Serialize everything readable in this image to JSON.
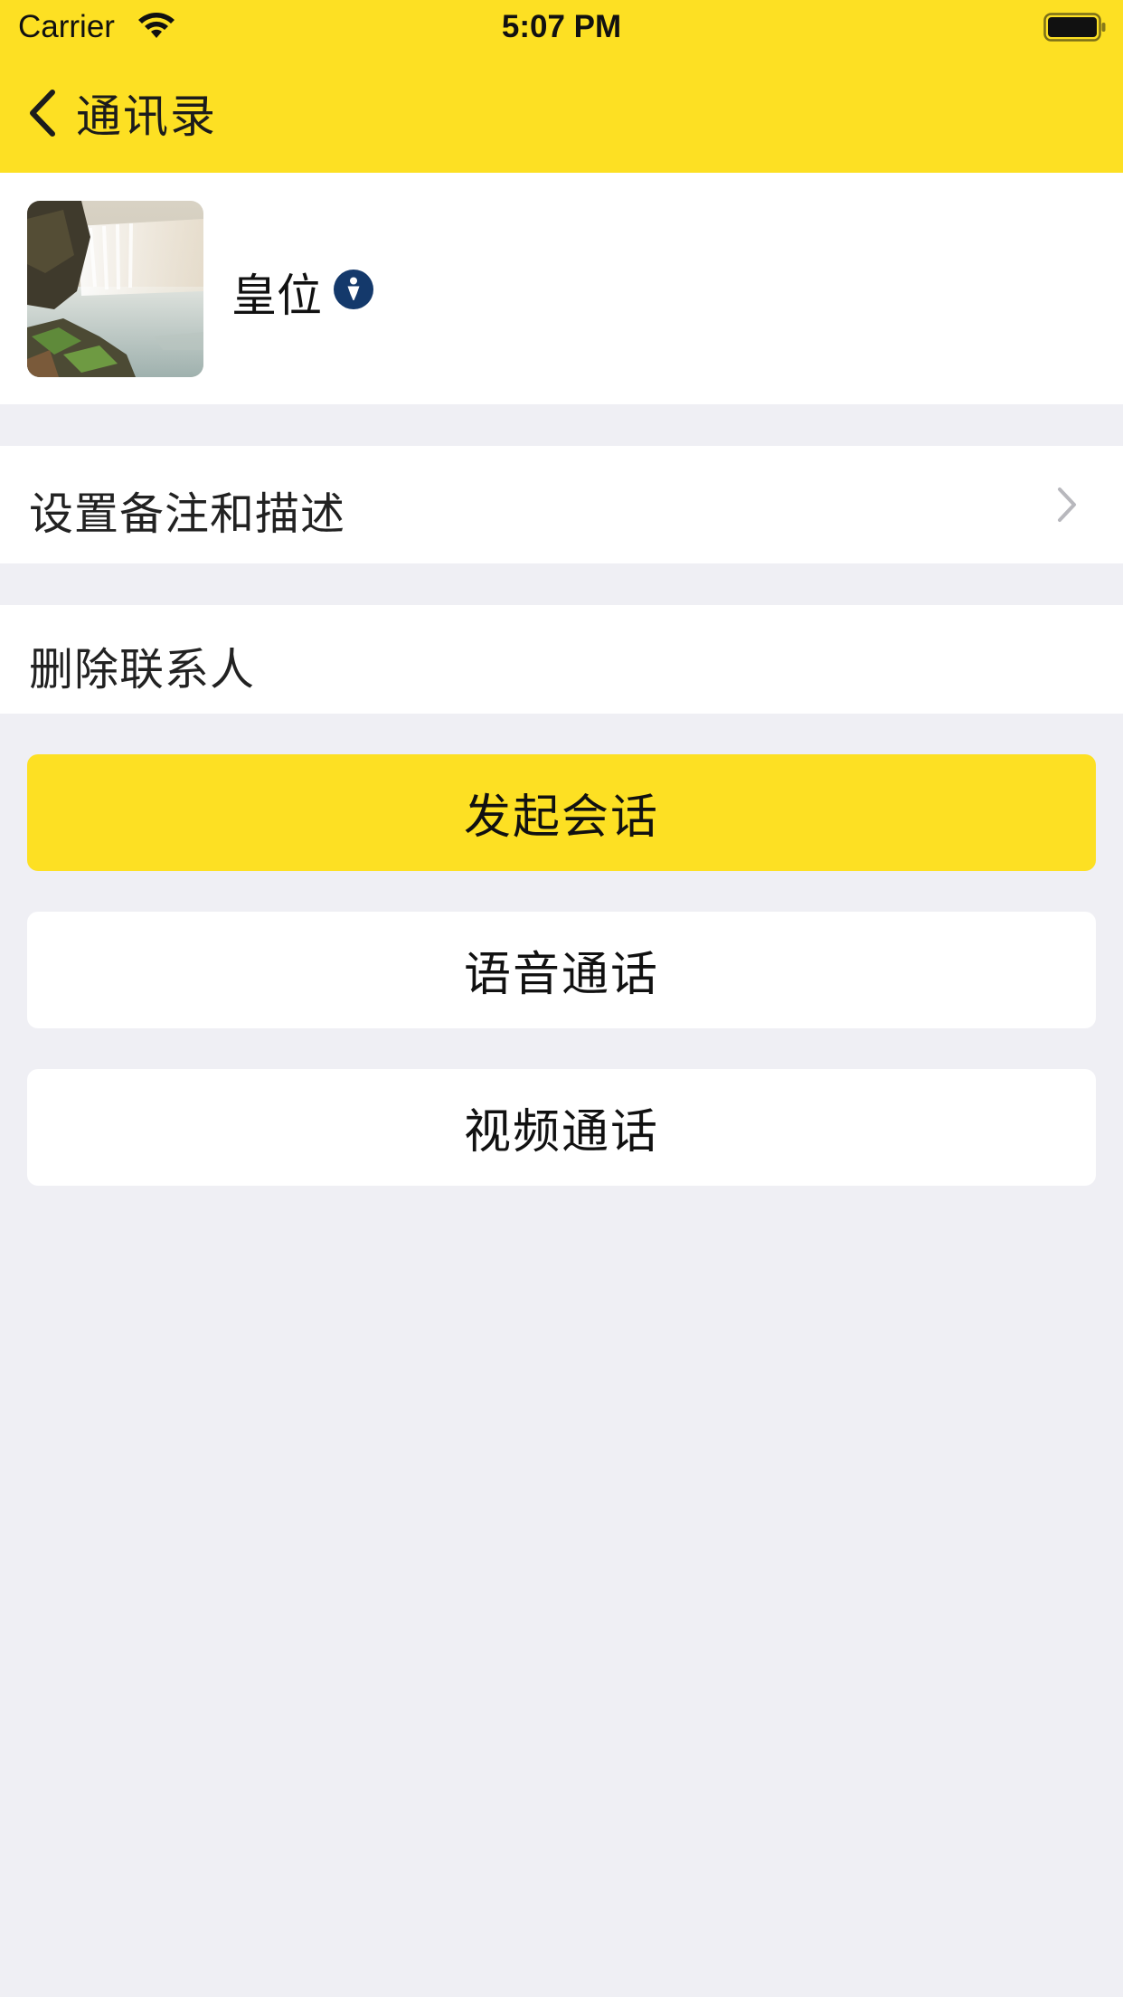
{
  "status_bar": {
    "carrier": "Carrier",
    "time": "5:07 PM"
  },
  "nav": {
    "back_label": "通讯录"
  },
  "profile": {
    "name": "皇位",
    "gender_icon": "male-icon",
    "avatar_icon": "waterfall-landscape-photo"
  },
  "menu": {
    "remark_label": "设置备注和描述",
    "delete_label": "删除联系人"
  },
  "actions": {
    "chat_label": "发起会话",
    "voice_label": "语音通话",
    "video_label": "视频通话"
  },
  "colors": {
    "accent_yellow": "#fde023",
    "background": "#efeff4",
    "gender_badge": "#14396b"
  }
}
